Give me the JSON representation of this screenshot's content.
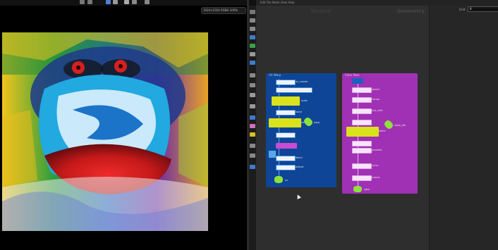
{
  "viewer": {
    "header_text": "1024×1024  RGBA  100%"
  },
  "graph": {
    "top_text": "Edit   File   Node   View   Help",
    "tab_texture": "Texture",
    "tab_geometry": "Geometry"
  },
  "inspector": {
    "field_label": "Grid",
    "field_value": "8"
  },
  "panels": {
    "blue": {
      "title": "UV Warp",
      "nodes": [
        {
          "label": "uv_coords"
        },
        {
          "label": "scale"
        },
        {
          "label": "noise"
        },
        {
          "label": "mix"
        },
        {
          "label": "warp"
        },
        {
          "label": "blend"
        },
        {
          "label": "output"
        }
      ],
      "output_label": "uv"
    },
    "purple": {
      "title": "Color Pass",
      "nodes": [
        {
          "label": "source"
        },
        {
          "label": "remap"
        },
        {
          "label": "hue_shift"
        },
        {
          "label": "blend"
        },
        {
          "label": "noise_tile"
        },
        {
          "label": "gradient"
        },
        {
          "label": "curve"
        },
        {
          "label": "output"
        }
      ],
      "output_label": "rgba"
    }
  },
  "colors": {
    "blue_panel": "#0f4596",
    "purple_panel": "#a031b4",
    "node_yellow": "#d9e21a",
    "node_green": "#8ee33a"
  }
}
